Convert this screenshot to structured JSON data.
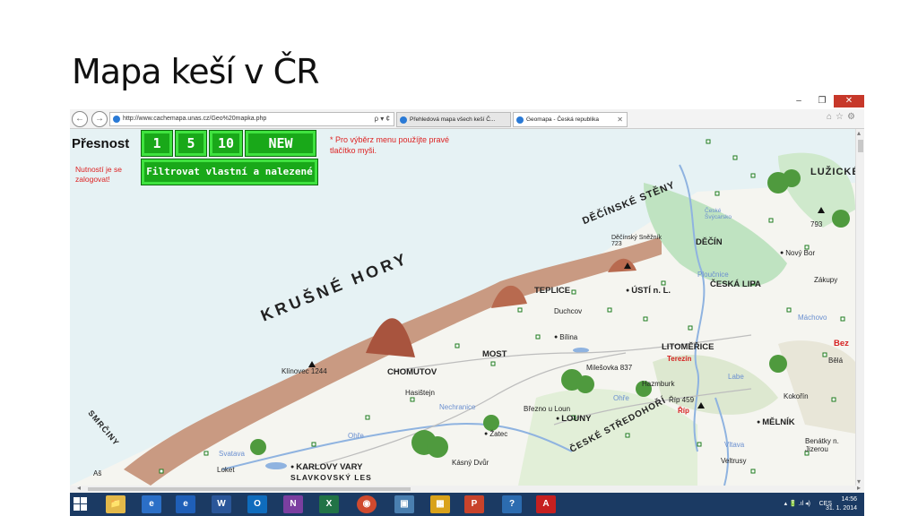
{
  "slide": {
    "title": "Mapa keší v ČR"
  },
  "browser": {
    "minimize": "–",
    "restore": "❐",
    "close": "✕",
    "back": "←",
    "forward": "→",
    "url": "http://www.cachemapa.unas.cz/Geo%20mapka.php",
    "url_tools": "ρ ▾ ¢",
    "tabs": [
      {
        "label": "Přehledová mapa všech keší Č...",
        "active": false
      },
      {
        "label": "Geomapa - Česká republika",
        "active": true,
        "close": "✕"
      }
    ],
    "right_icons": "⌂☆⚙"
  },
  "map": {
    "presnost_label": "Přesnost",
    "precision_buttons": [
      "1",
      "5",
      "10"
    ],
    "new_button": "NEW",
    "filter_button": "Filtrovat vlastní a nalezené",
    "login_notice": "Nutností je se zalogovat!",
    "menu_hint": "* Pro výběrz menu použíjte pravé tlačítko myši.",
    "labels": {
      "krusne_hory": "KRUŠNÉ HORY",
      "decinske_steny": "DĚČÍNSKÉ STĚNY",
      "luzicke": "LUŽICKÉ",
      "smrciny": "SMRČINY",
      "ceske_stredohori": "ČESKÉ STŘEDOHOŘÍ",
      "slavkovsky_les": "SLAVKOVSKÝ LES",
      "klinovec": "Klínovec 1244",
      "chomutov": "CHOMUTOV",
      "hasistejn": "Hasištejn",
      "most": "MOST",
      "bilina": "Bílina",
      "teplice": "TEPLICE",
      "duchcov": "Duchcov",
      "usti": "ÚSTÍ n. L.",
      "decin": "DĚČÍN",
      "snezka": "Děčínský Sněžník 723",
      "ceska_lipa": "ČESKÁ LIPA",
      "novy_bor": "Nový Bor",
      "zakupy": "Zákupy",
      "litomerice": "LITOMĚŘICE",
      "terezin": "Terezín",
      "hazmburk": "Hazmburk",
      "rip": "Říp 459",
      "rip2": "Říp",
      "kokorin": "Kokořín",
      "melnik": "MĚLNÍK",
      "bela": "Bělá",
      "beze": "Bez",
      "benatky": "Benátky n. Jizerou",
      "veltrusy": "Veltrusy",
      "louny": "LOUNY",
      "brezno": "Březno u Loun",
      "zatec": "Žatec",
      "kasny_dvur": "Kásný Dvůr",
      "karlovy_vary": "KARLOVY VARY",
      "loket": "Loket",
      "ohre1": "Ohře",
      "ohre2": "Ohře",
      "svatava": "Svatava",
      "nechranice": "Nechranice",
      "milesovka": "Milešovka 837",
      "cheb": "Aš",
      "madlo": "Máchovo",
      "labe": "Labe",
      "ploucnice": "Ploučnice",
      "vltava": "Vltava",
      "hora793": "793",
      "cr_lbl": "České Švýcarsko"
    }
  },
  "taskbar": {
    "apps": [
      "📁",
      "e",
      "e",
      "W",
      "O",
      "N",
      "X",
      "◉",
      "▣",
      "▦",
      "P",
      "?",
      "A"
    ],
    "tray_lang": "CES",
    "tray_time": "14:56",
    "tray_date": "31. 1. 2014",
    "tray_icons": "▴ 🔋 .ıl ◂)"
  }
}
